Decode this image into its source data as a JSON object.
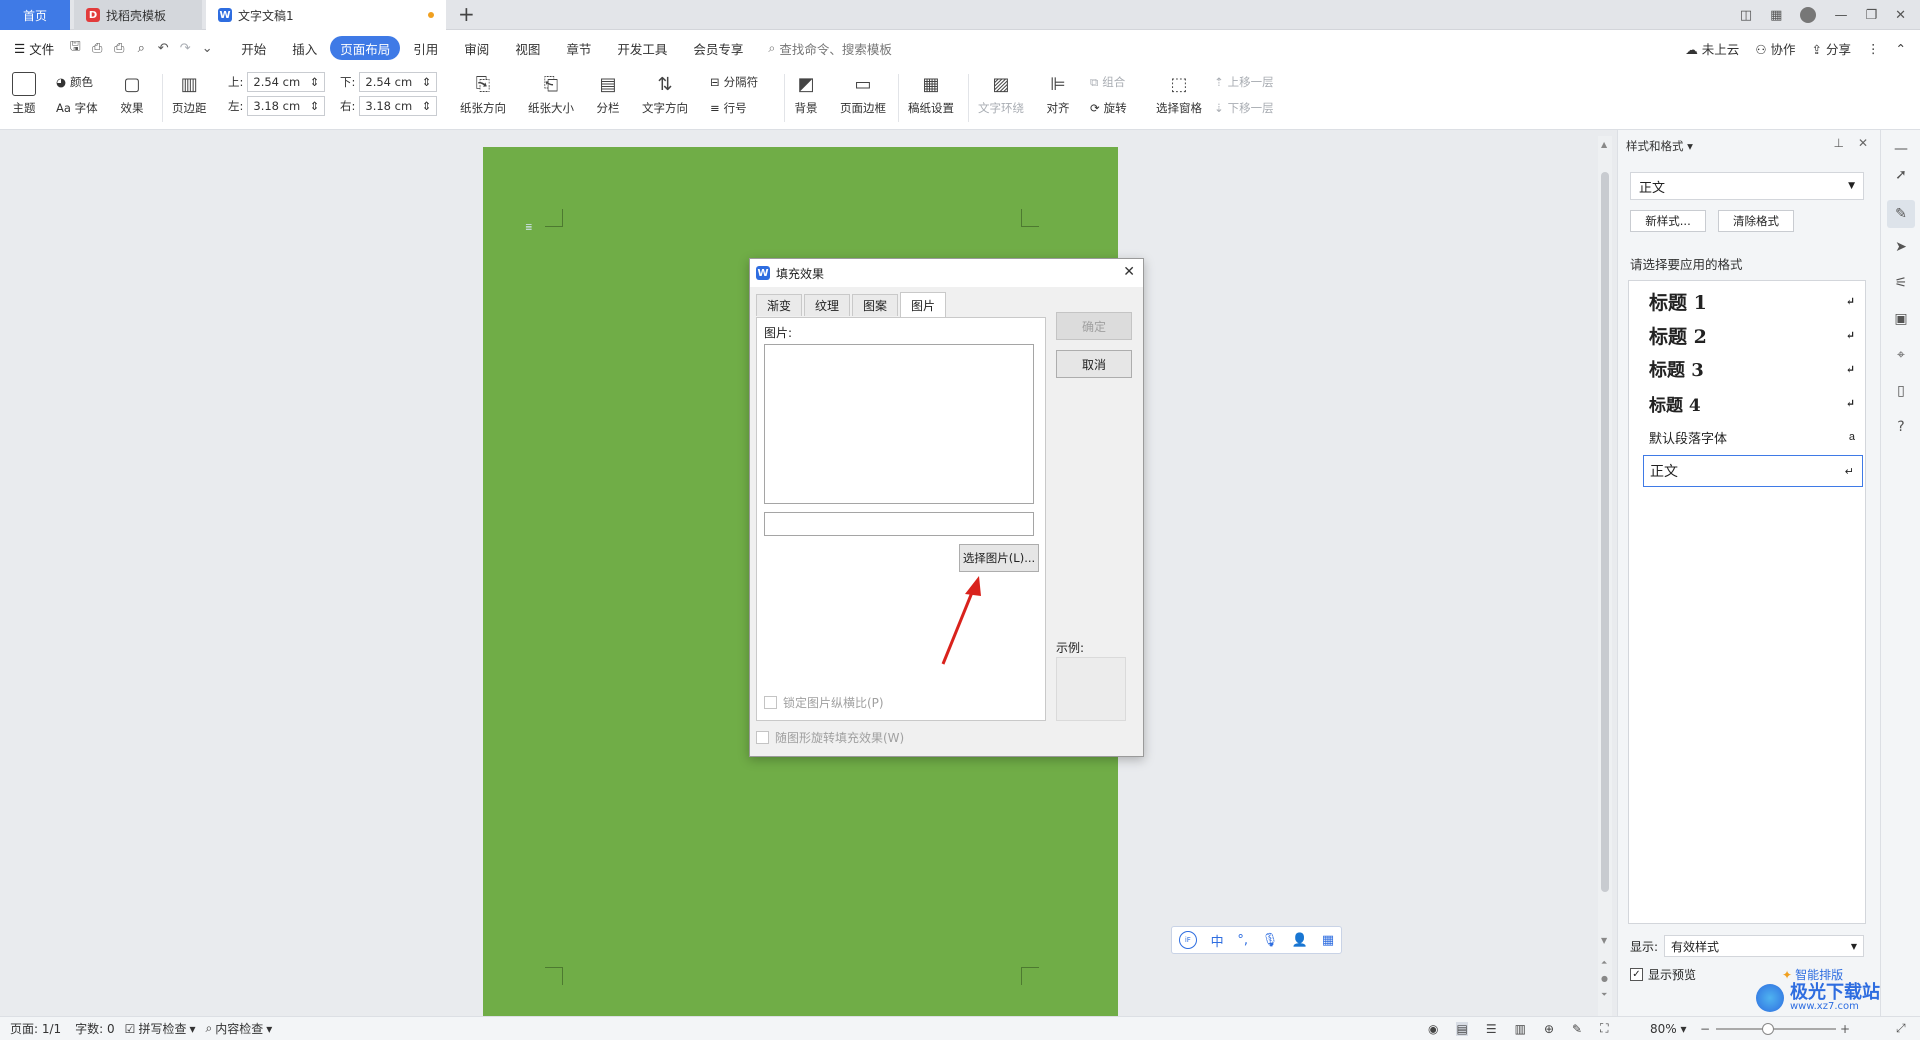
{
  "tabs": [
    {
      "label": "首页"
    },
    {
      "label": "找稻壳模板"
    },
    {
      "label": "文字文稿1"
    }
  ],
  "menu": {
    "file_label": "文件",
    "items": [
      "开始",
      "插入",
      "页面布局",
      "引用",
      "审阅",
      "视图",
      "章节",
      "开发工具",
      "会员专享"
    ],
    "active": "页面布局",
    "search_placeholder": "查找命令、搜索模板",
    "right": [
      "未上云",
      "协作",
      "分享"
    ]
  },
  "ribbon": {
    "theme": "主题",
    "color": "颜色",
    "font": "Aa 字体",
    "effect": "效果",
    "margin": "页边距",
    "top_label": "上:",
    "top_value": "2.54 cm",
    "bottom_label": "下:",
    "bottom_value": "2.54 cm",
    "left_label": "左:",
    "left_value": "3.18 cm",
    "right_label": "右:",
    "right_value": "3.18 cm",
    "orientation": "纸张方向",
    "size": "纸张大小",
    "columns": "分栏",
    "text_direction": "文字方向",
    "separator": "分隔符",
    "line_number": "行号",
    "background": "背景",
    "page_border": "页面边框",
    "manuscript": "稿纸设置",
    "text_wrap": "文字环绕",
    "align": "对齐",
    "group": "组合",
    "rotate": "旋转",
    "selection_pane": "选择窗格",
    "bring_forward": "上移一层",
    "send_backward": "下移一层"
  },
  "dialog": {
    "title": "填充效果",
    "tabs": [
      "渐变",
      "纹理",
      "图案",
      "图片"
    ],
    "active_tab": "图片",
    "picture_label": "图片:",
    "select_button": "选择图片(L)...",
    "lock_ratio": "锁定图片纵横比(P)",
    "rotate_fill": "随图形旋转填充效果(W)",
    "ok": "确定",
    "cancel": "取消",
    "sample_label": "示例:"
  },
  "styles_panel": {
    "header": "样式和格式",
    "current_style": "正文",
    "new_style": "新样式...",
    "clear_format": "清除格式",
    "prompt": "请选择要应用的格式",
    "items": [
      {
        "label": "标题 1"
      },
      {
        "label": "标题 2"
      },
      {
        "label": "标题 3"
      },
      {
        "label": "标题 4"
      },
      {
        "label": "默认段落字体"
      },
      {
        "label": "正文"
      }
    ],
    "show_label": "显示:",
    "show_value": "有效样式",
    "show_preview": "显示预览",
    "smart_layout": "智能排版"
  },
  "statusbar": {
    "page": "页面: 1/1",
    "words": "字数: 0",
    "spell": "拼写检查",
    "content": "内容检查",
    "zoom": "80%"
  },
  "ime": {
    "cn": "中"
  },
  "watermark": {
    "text": "极光下载站",
    "url": "www.xz7.com"
  },
  "colors": {
    "accent": "#3f7ae6",
    "page": "#70ad47",
    "arrow": "#d9221c"
  }
}
